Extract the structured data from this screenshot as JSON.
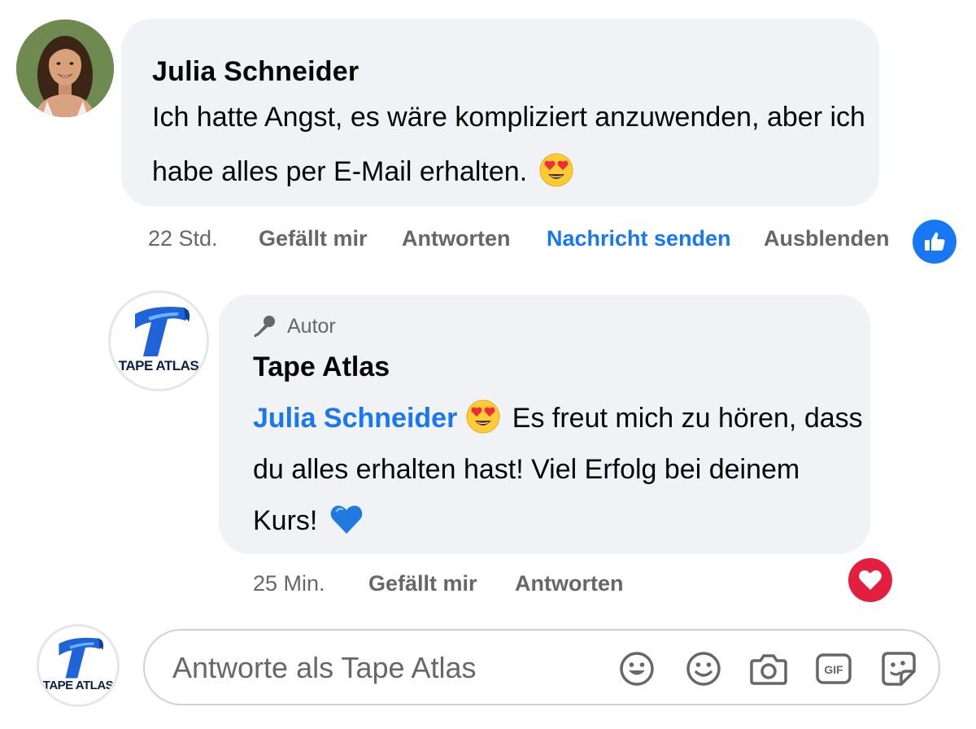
{
  "comment": {
    "author": "Julia Schneider",
    "text_before_emoji": "Ich hatte Angst, es wäre kompliziert anzuwenden, aber ich habe alles per E-Mail erhalten.",
    "emoji": "heart-eyes",
    "time": "22 Std.",
    "actions": {
      "like": "Gefällt mir",
      "reply": "Antworten",
      "message": "Nachricht senden",
      "hide": "Ausblenden"
    },
    "reaction": "like"
  },
  "reply": {
    "badge": "Autor",
    "author": "Tape Atlas",
    "mention": "Julia Schneider",
    "text_main": "Es freut mich zu hören, dass du alles erhalten hast! Viel Erfolg bei deinem Kurs!",
    "emoji_after_mention": "heart-eyes",
    "emoji_end": "blue-heart",
    "time": "25 Min.",
    "actions": {
      "like": "Gefällt mir",
      "reply": "Antworten"
    },
    "reaction": "love"
  },
  "page_logo": {
    "text": "TAPE ATLAS"
  },
  "composer": {
    "placeholder": "Antworte als Tape Atlas",
    "icons": [
      "emoji-icon",
      "smiley-icon",
      "camera-icon",
      "gif-icon",
      "sticker-icon"
    ],
    "gif_label": "GIF"
  },
  "colors": {
    "accent_blue": "#1877f2",
    "love_red": "#e41e3f",
    "bubble_bg": "#f0f2f5",
    "muted": "#65676b"
  }
}
